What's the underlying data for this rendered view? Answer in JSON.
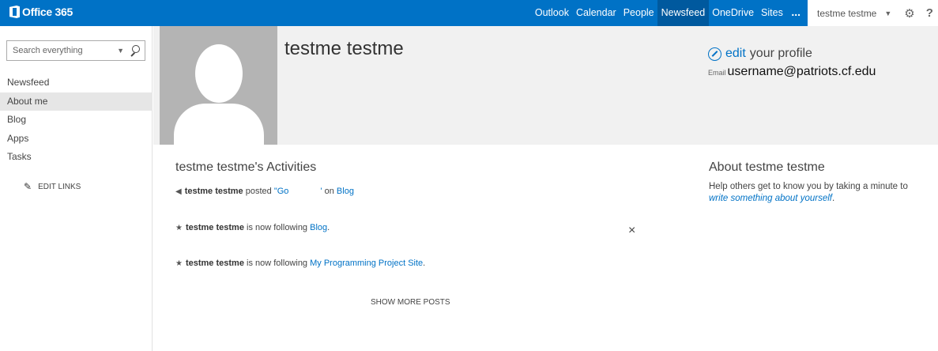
{
  "topbar": {
    "logo_text": "Office 365",
    "nav": [
      "Outlook",
      "Calendar",
      "People",
      "Newsfeed",
      "OneDrive",
      "Sites"
    ],
    "active_nav": "Newsfeed",
    "more_label": "...",
    "user_name": "testme testme",
    "icons": [
      "office-logo-icon",
      "user-menu-caret-icon",
      "gear-icon",
      "help-icon"
    ],
    "accent_color": "#0072c6"
  },
  "leftnav": {
    "search_placeholder": "Search everything",
    "items": [
      "Newsfeed",
      "About me",
      "Blog",
      "Apps",
      "Tasks"
    ],
    "selected": "About me",
    "edit_links_label": "EDIT LINKS"
  },
  "profile": {
    "name": "testme testme",
    "edit_link": "edit",
    "edit_suffix": "your profile",
    "email_label": "Email",
    "email_value": "username@patriots.cf.edu"
  },
  "activities": {
    "title": "testme testme's Activities",
    "items": [
      {
        "icon": "megaphone-icon",
        "actor": "testme testme",
        "verb": "posted",
        "quote_link": "\"Go",
        "quote_end": "'",
        "prep": "on",
        "target": "Blog",
        "suffix": ""
      },
      {
        "icon": "star-icon",
        "actor": "testme testme",
        "verb": "is now following",
        "target": "Blog",
        "suffix": "."
      },
      {
        "icon": "star-icon",
        "actor": "testme testme",
        "verb": "is now following",
        "target": "My Programming Project Site",
        "suffix": "."
      }
    ],
    "dismiss_label": "×",
    "show_more_label": "SHOW MORE POSTS"
  },
  "about": {
    "title": "About testme testme",
    "text": "Help others get to know you by taking a minute to",
    "link": "write something about yourself",
    "link_suffix": "."
  }
}
